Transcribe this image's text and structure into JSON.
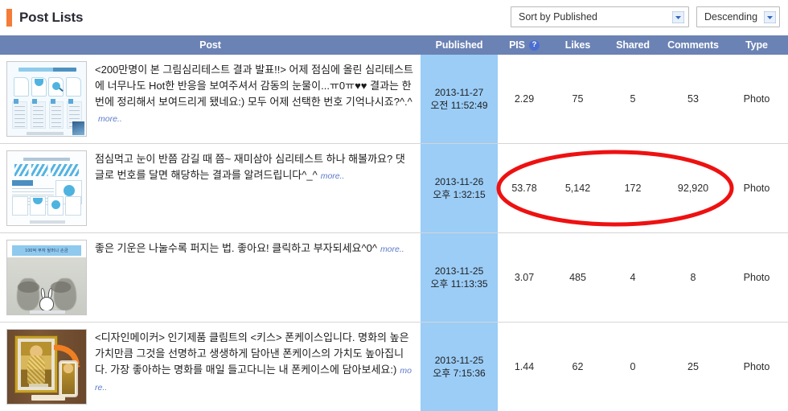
{
  "header": {
    "title": "Post Lists",
    "accent_color": "#f47b38",
    "sort_select": {
      "value": "Sort by Published",
      "icon": "chevron-down-icon"
    },
    "order_select": {
      "value": "Descending",
      "icon": "chevron-down-icon"
    }
  },
  "table": {
    "header_bg": "#6b82b4",
    "published_bg": "#9bcdf7",
    "columns": {
      "post": "Post",
      "published": "Published",
      "pis": "PIS",
      "pis_help": "?",
      "likes": "Likes",
      "shared": "Shared",
      "comments": "Comments",
      "type": "Type"
    },
    "rows": [
      {
        "thumb_alt": "psychology-test-result-infographic",
        "text": "<200만명이 본 그림심리테스트 결과 발표!!> 어제 점심에 올린 심리테스트에 너무나도 Hot한 반응을 보여주셔서 감동의 눈물이...ㅠ0ㅠ♥♥ 결과는 한번에 정리해서 보여드리게 됐네요:) 모두 어제 선택한 번호 기억나시죠?^.^",
        "more": "more..",
        "published_date": "2013-11-27",
        "published_time": "오전 11:52:49",
        "pis": "2.29",
        "likes": "75",
        "shared": "5",
        "comments": "53",
        "type": "Photo",
        "highlighted": false
      },
      {
        "thumb_alt": "handwritten-psychology-test-cover",
        "text": "점심먹고 눈이 반쯤 감길 때 쯤~ 재미삼아 심리테스트 하나 해볼까요? 댓글로 번호를 달면 해당하는 결과를 알려드립니다^_^",
        "more": "more..",
        "published_date": "2013-11-26",
        "published_time": "오후 1:32:15",
        "pis": "53.78",
        "likes": "5,142",
        "shared": "172",
        "comments": "92,920",
        "type": "Photo",
        "highlighted": true
      },
      {
        "thumb_alt": "handprints-photo-with-rabbit",
        "text": "좋은 기운은 나눌수록 퍼지는 법. 좋아요! 클릭하고 부자되세요^0^",
        "more": "more..",
        "published_date": "2013-11-25",
        "published_time": "오후 11:13:35",
        "pis": "3.07",
        "likes": "485",
        "shared": "4",
        "comments": "8",
        "type": "Photo",
        "highlighted": false
      },
      {
        "thumb_alt": "klimt-the-kiss-phone-case",
        "text": "<디자인메이커> 인기제품 클림트의 <키스> 폰케이스입니다. 명화의 높은 가치만큼 그것을 선명하고 생생하게 담아낸 폰케이스의 가치도 높아집니다. 가장 좋아하는 명화를 매일 들고다니는 내 폰케이스에 담아보세요:)",
        "more": "more..",
        "published_date": "2013-11-25",
        "published_time": "오후 7:15:36",
        "pis": "1.44",
        "likes": "62",
        "shared": "0",
        "comments": "25",
        "type": "Photo",
        "highlighted": false
      }
    ]
  },
  "annotation": {
    "shape": "ellipse",
    "color": "#ee1111",
    "targets": "row-2 pis likes shared comments"
  },
  "thumb_captions": {
    "row3_caption": "100억 부자 될머니 손금"
  }
}
